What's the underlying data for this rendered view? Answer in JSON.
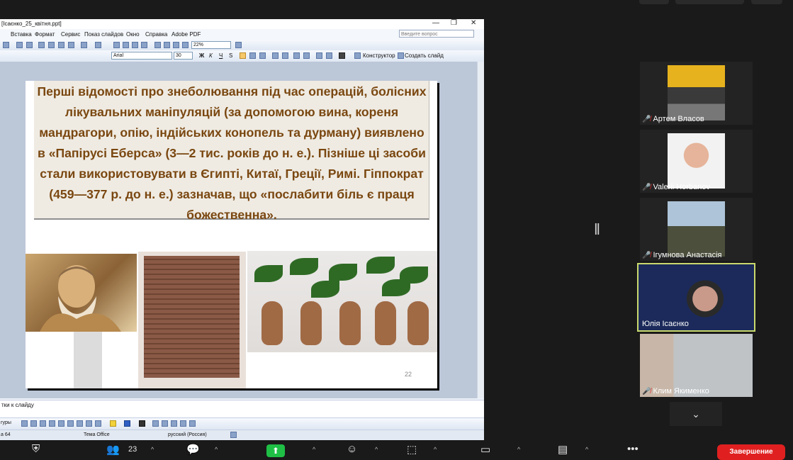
{
  "ppt": {
    "window_title": "[Ісаєнко_25_квітня.ppt]",
    "menu": [
      "Вставка",
      "Формат",
      "Сервис",
      "Показ слайдов",
      "Окно",
      "Справка",
      "Adobe PDF"
    ],
    "help_placeholder": "Введите вопрос",
    "zoom": "22%",
    "font_name": "Arial",
    "font_size": "30",
    "bold": "Ж",
    "italic": "К",
    "underline": "Ч",
    "shadow": "S",
    "constructor": "Конструктор",
    "new_slide": "Создать слайд",
    "notes_placeholder": "тки к слайду",
    "draw_label": "гуры",
    "status": {
      "slide": "а 64",
      "theme": "Тема Office",
      "language": "русский (Россия)"
    }
  },
  "slide": {
    "text": "Перші відомості про знеболювання під час операцій, болісних лікувальних маніпуляцій (за допомогою вина, кореня мандрагори, опію, індійських конопель та дурману) виявлено в «Папірусі Еберса» (3—2 тис. років до н. е.). Пізніше ці засоби стали використовувати в Єгипті, Китаї, Греції, Римі. Гіппократ (459—377 р. до н. е.) зазначав, що «послабити біль є праця божественна».",
    "number": "22"
  },
  "participants": [
    {
      "name": "Артем Власов",
      "muted": true
    },
    {
      "name": "Valerii Horbanov",
      "muted": true
    },
    {
      "name": "Ігумнова Анастасія",
      "muted": true
    },
    {
      "name": "Юлія Ісаєнко",
      "muted": false,
      "active": true
    },
    {
      "name": "Клим Якименко",
      "muted": true
    }
  ],
  "zoom_toolbar": {
    "participants_count": "23",
    "leave": "Завершение"
  },
  "colors": {
    "slide_text": "#7a4710",
    "active_speaker_border": "#c9d96d",
    "leave_button": "#e02020",
    "share_button": "#1fbf46"
  }
}
